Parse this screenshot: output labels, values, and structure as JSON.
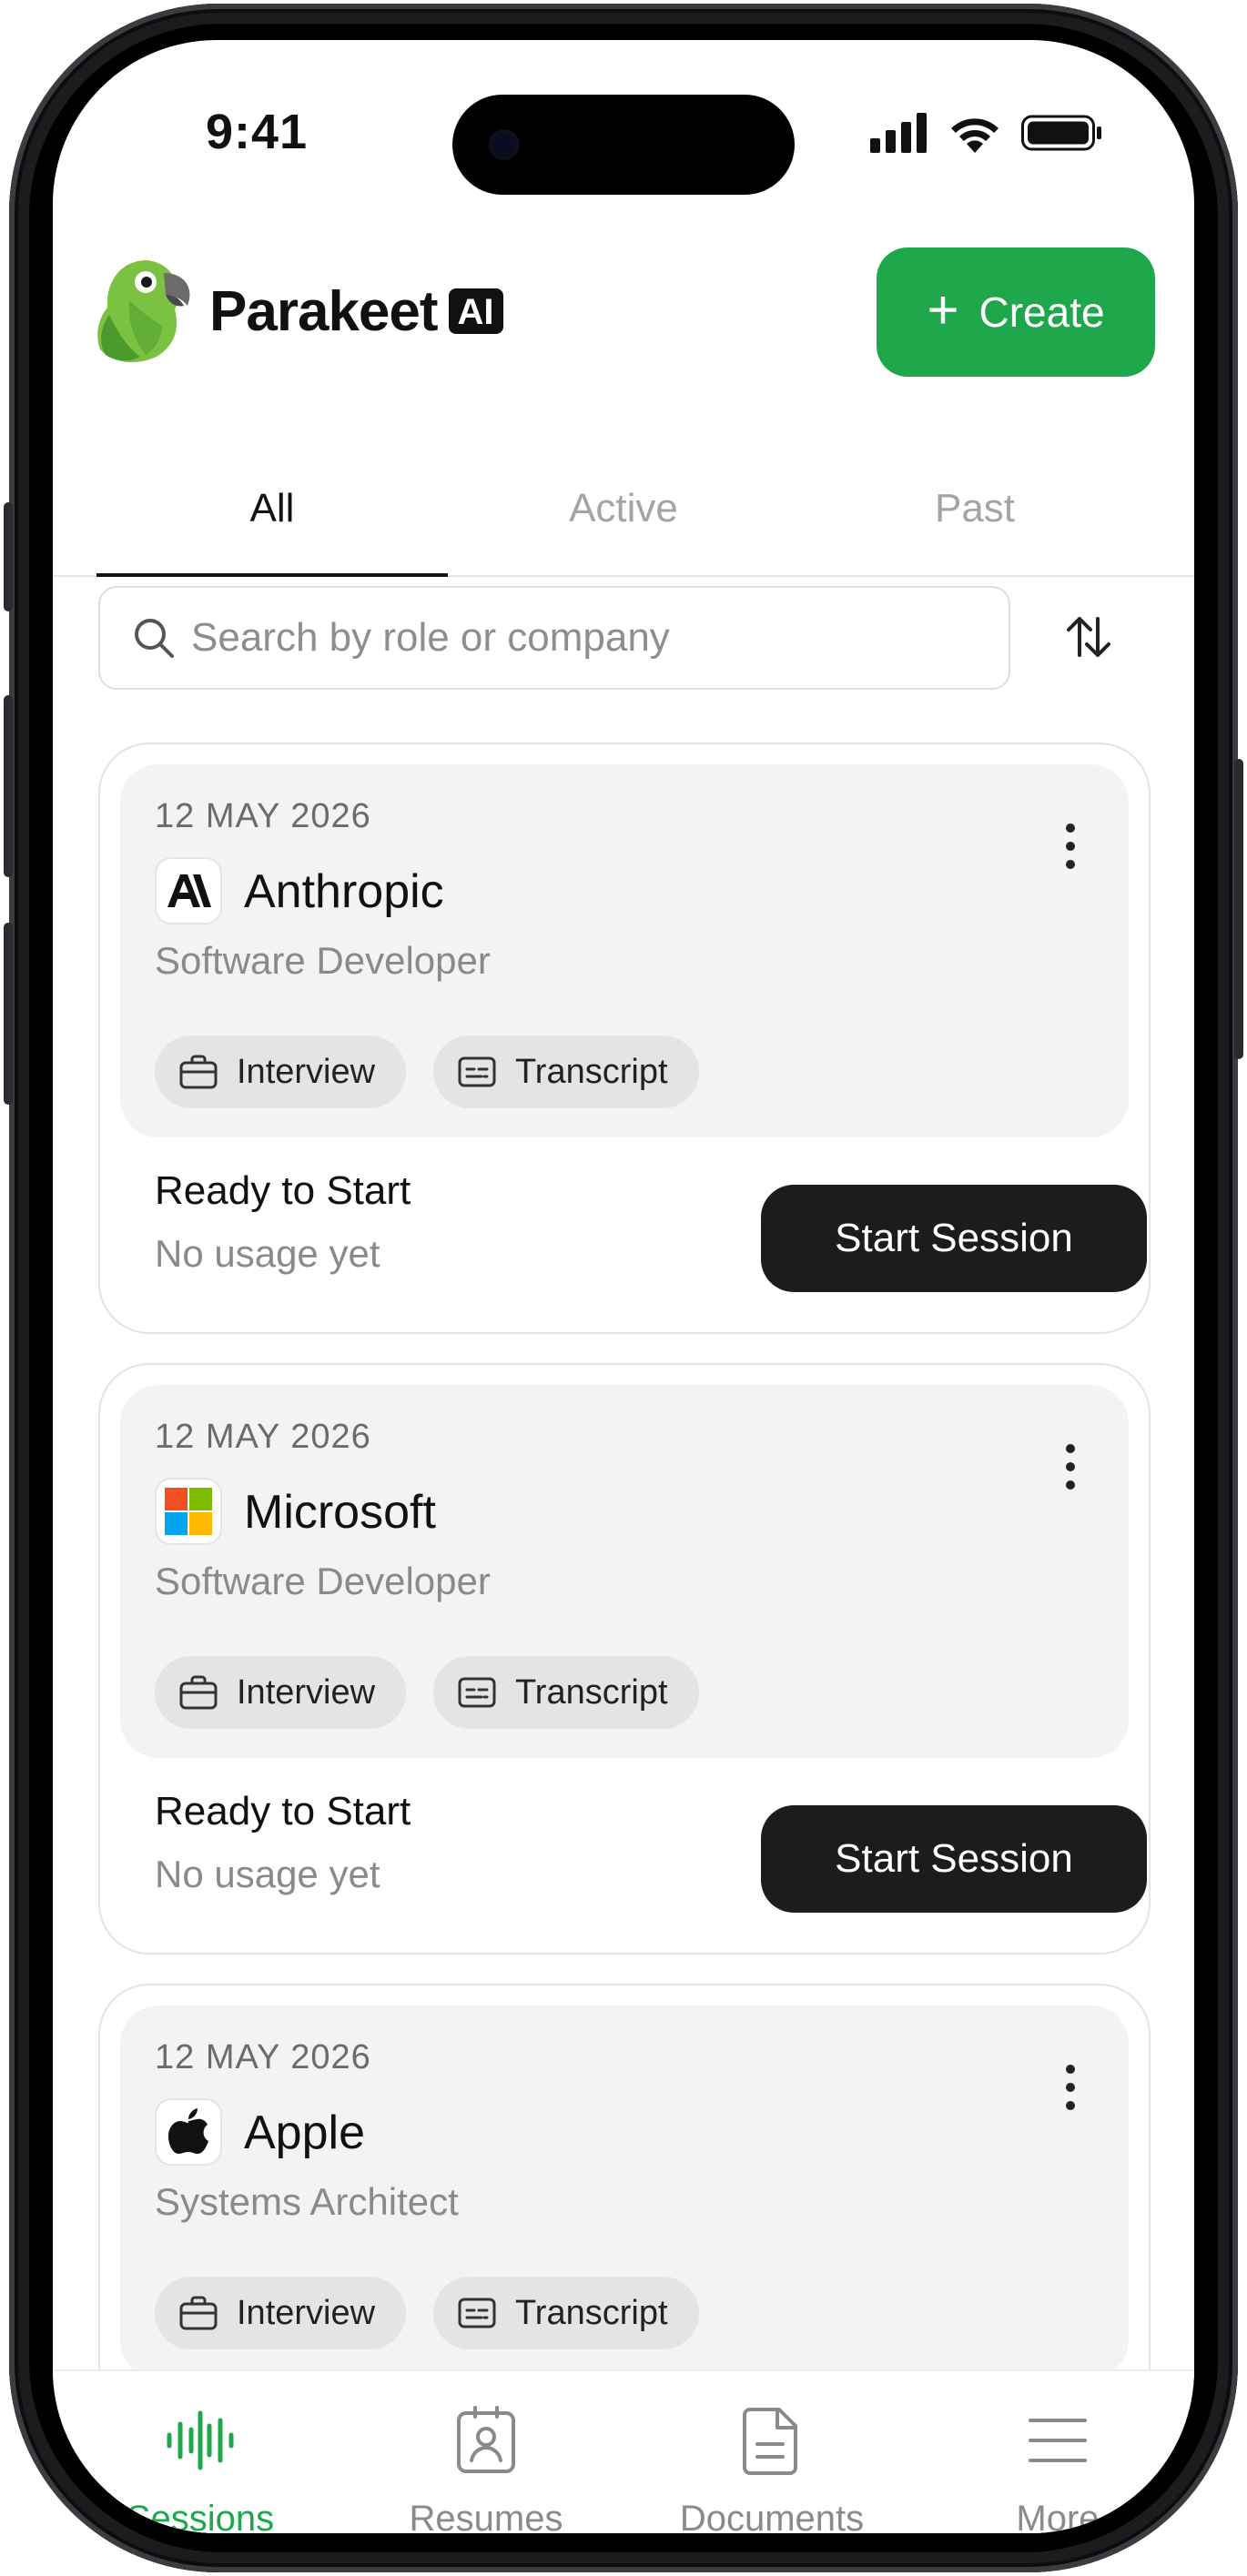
{
  "status_bar": {
    "time": "9:41"
  },
  "header": {
    "brand": "Parakeet",
    "brand_badge": "AI",
    "create_label": "Create"
  },
  "tabs": [
    {
      "label": "All",
      "active": true
    },
    {
      "label": "Active",
      "active": false
    },
    {
      "label": "Past",
      "active": false
    }
  ],
  "search": {
    "placeholder": "Search by role or company"
  },
  "sessions": [
    {
      "date": "12 MAY 2026",
      "company": "Anthropic",
      "logo": "anthropic-logo",
      "role": "Software Developer",
      "tags": [
        "Interview",
        "Transcript"
      ],
      "status_title": "Ready to Start",
      "status_sub": "No usage yet",
      "action_label": "Start Session"
    },
    {
      "date": "12 MAY 2026",
      "company": "Microsoft",
      "logo": "microsoft-logo",
      "role": "Software Developer",
      "tags": [
        "Interview",
        "Transcript"
      ],
      "status_title": "Ready to Start",
      "status_sub": "No usage yet",
      "action_label": "Start Session"
    },
    {
      "date": "12 MAY 2026",
      "company": "Apple",
      "logo": "apple-logo",
      "role": "Systems Architect",
      "tags": [
        "Interview",
        "Transcript"
      ]
    }
  ],
  "bottom_nav": [
    {
      "label": "Sessions",
      "icon": "waveform-icon",
      "active": true
    },
    {
      "label": "Resumes",
      "icon": "badge-icon",
      "active": false
    },
    {
      "label": "Documents",
      "icon": "document-icon",
      "active": false
    },
    {
      "label": "More",
      "icon": "menu-icon",
      "active": false
    }
  ],
  "colors": {
    "accent": "#1fa84b",
    "dark_button": "#1c1c1e",
    "card_fill": "#f3f3f3"
  }
}
